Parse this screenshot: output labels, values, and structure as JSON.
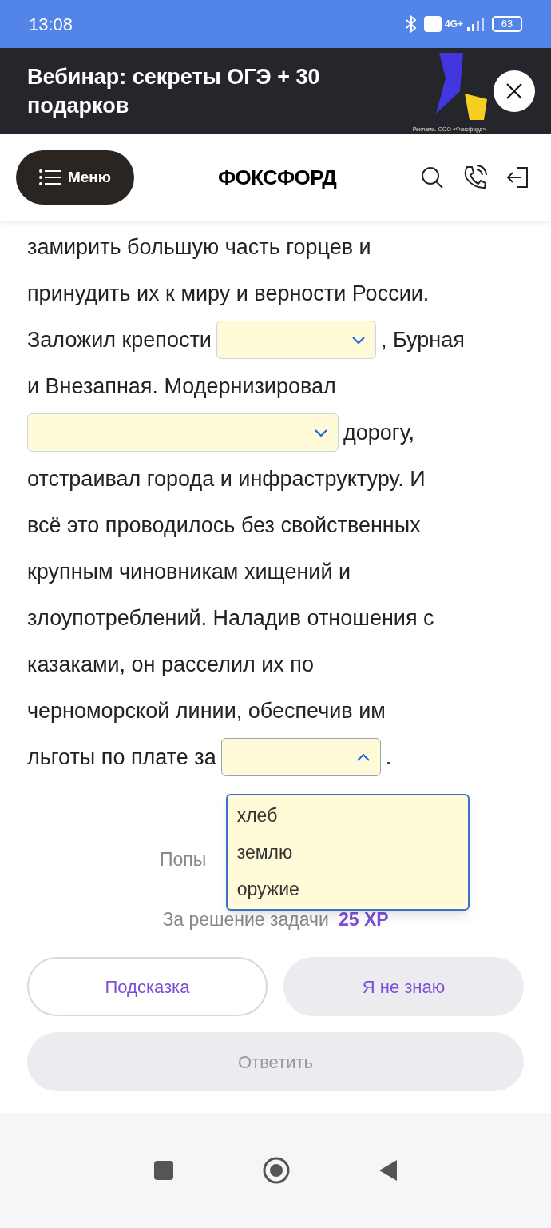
{
  "status_bar": {
    "time": "13:08",
    "battery": "63",
    "network": "4G+"
  },
  "ad_banner": {
    "title": "Вебинар: секреты ОГЭ + 30 подарков",
    "disclaimer": "Реклама. ООО «Фоксфорд»."
  },
  "header": {
    "menu_label": "Меню",
    "logo": "ФОКСФОРД"
  },
  "text_lines": [
    {
      "segments": [
        {
          "kind": "text",
          "text": "замирить большую часть горцев и"
        }
      ]
    },
    {
      "segments": [
        {
          "kind": "text",
          "text": "принудить их к миру и верности России."
        }
      ]
    },
    {
      "segments": [
        {
          "kind": "text",
          "text": "Заложил крепости"
        },
        {
          "kind": "select",
          "expanded": false
        },
        {
          "kind": "text",
          "text": ", Бурная"
        }
      ]
    },
    {
      "segments": [
        {
          "kind": "text",
          "text": "и Внезапная. Модернизировал"
        }
      ]
    },
    {
      "segments": [
        {
          "kind": "select",
          "expanded": false
        },
        {
          "kind": "text",
          "text": "дорогу,"
        }
      ]
    },
    {
      "segments": [
        {
          "kind": "text",
          "text": "отстраивал города и инфраструктуру. И"
        }
      ]
    },
    {
      "segments": [
        {
          "kind": "text",
          "text": "всё это проводилось без свойственных"
        }
      ]
    },
    {
      "segments": [
        {
          "kind": "text",
          "text": "крупным чиновникам хищений и"
        }
      ]
    },
    {
      "segments": [
        {
          "kind": "text",
          "text": "злоупотреблений. Наладив отношения с"
        }
      ]
    },
    {
      "segments": [
        {
          "kind": "text",
          "text": "казаками, он расселил их по"
        }
      ]
    },
    {
      "segments": [
        {
          "kind": "text",
          "text": "черноморской линии, обеспечив им"
        }
      ]
    },
    {
      "segments": [
        {
          "kind": "text",
          "text": "льготы по плате за"
        },
        {
          "kind": "select",
          "expanded": true,
          "options": [
            "хлеб",
            "землю",
            "оружие"
          ]
        },
        {
          "kind": "text",
          "text": "."
        }
      ]
    }
  ],
  "attempts": "Попы",
  "reward": {
    "label": "За решение задачи",
    "points": "25 XP"
  },
  "buttons": [
    {
      "kind": "outline",
      "label": "Подсказка"
    },
    {
      "kind": "soft",
      "label": "Я не знаю"
    },
    {
      "kind": "primary",
      "label": "Ответить",
      "disabled": true
    }
  ]
}
